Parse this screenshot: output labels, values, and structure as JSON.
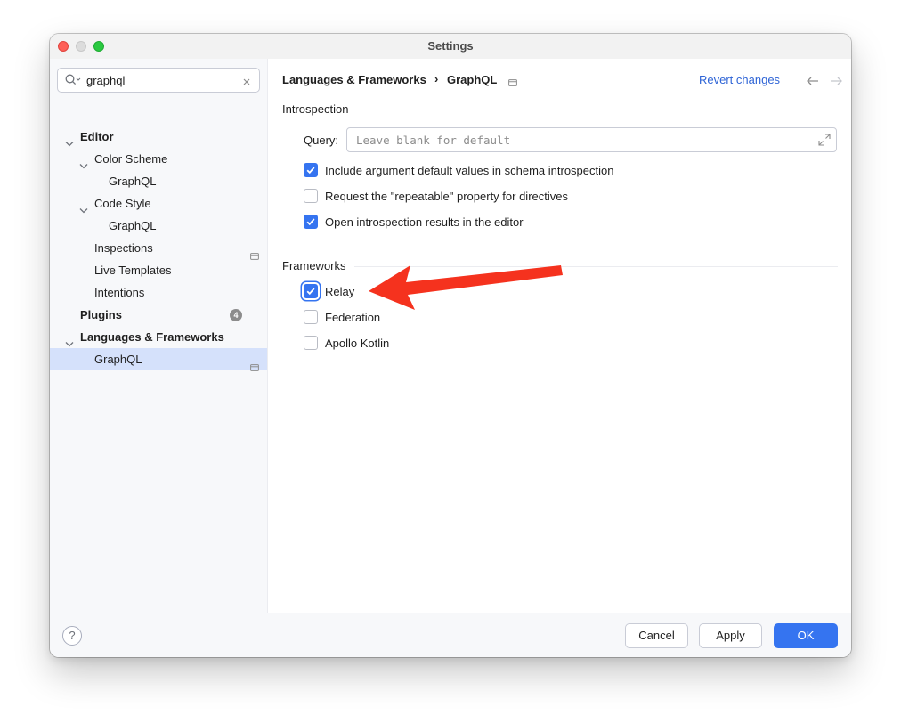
{
  "window": {
    "title": "Settings"
  },
  "search": {
    "value": "graphql"
  },
  "tree": {
    "editor": "Editor",
    "color_scheme": "Color Scheme",
    "color_scheme_graphql": "GraphQL",
    "code_style": "Code Style",
    "code_style_graphql": "GraphQL",
    "inspections": "Inspections",
    "live_templates": "Live Templates",
    "intentions": "Intentions",
    "plugins": "Plugins",
    "plugins_badge": "4",
    "languages_frameworks": "Languages & Frameworks",
    "graphql": "GraphQL"
  },
  "breadcrumb": {
    "parent": "Languages & Frameworks",
    "separator": "›",
    "current": "GraphQL"
  },
  "header": {
    "revert": "Revert changes"
  },
  "introspection": {
    "title": "Introspection",
    "query_label": "Query:",
    "query_placeholder": "Leave blank for default",
    "options": [
      {
        "label": "Include argument default values in schema introspection",
        "checked": true
      },
      {
        "label": "Request the \"repeatable\" property for directives",
        "checked": false
      },
      {
        "label": "Open introspection results in the editor",
        "checked": true
      }
    ]
  },
  "frameworks": {
    "title": "Frameworks",
    "options": [
      {
        "label": "Relay",
        "checked": true
      },
      {
        "label": "Federation",
        "checked": false
      },
      {
        "label": "Apollo Kotlin",
        "checked": false
      }
    ]
  },
  "footer": {
    "help": "?",
    "cancel": "Cancel",
    "apply": "Apply",
    "ok": "OK"
  },
  "colors": {
    "accent": "#3574f0",
    "annotation_arrow": "#f5321e",
    "selection": "#d5e1fb",
    "link": "#2e64d6"
  }
}
